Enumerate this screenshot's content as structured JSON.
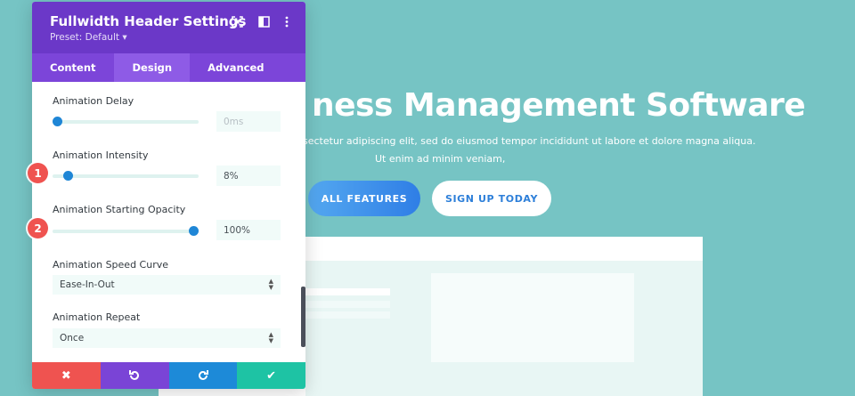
{
  "hero": {
    "title": "ness Management Software",
    "subtitle_line1": "sectetur adipiscing elit, sed do eiusmod tempor incididunt ut labore et dolore magna aliqua.",
    "subtitle_line2": "Ut enim ad minim veniam,",
    "primary_button": "ALL FEATURES",
    "secondary_button": "SIGN UP TODAY"
  },
  "panel": {
    "title": "Fullwidth Header Settings",
    "preset": "Preset: Default ▾",
    "tabs": [
      {
        "label": "Content",
        "active": false
      },
      {
        "label": "Design",
        "active": true
      },
      {
        "label": "Advanced",
        "active": false
      }
    ],
    "fields": {
      "animation_delay": {
        "label": "Animation Delay",
        "value": "0ms",
        "slider_fraction": 0.0
      },
      "animation_intensity": {
        "label": "Animation Intensity",
        "value": "8%",
        "slider_fraction": 0.08
      },
      "animation_starting_opacity": {
        "label": "Animation Starting Opacity",
        "value": "100%",
        "slider_fraction": 1.0
      },
      "animation_speed_curve": {
        "label": "Animation Speed Curve",
        "value": "Ease-In-Out"
      },
      "animation_repeat": {
        "label": "Animation Repeat",
        "value": "Once"
      }
    },
    "badges": [
      "1",
      "2"
    ],
    "footer": {
      "cancel_icon": "close-icon",
      "undo_icon": "undo-icon",
      "redo_icon": "redo-icon",
      "save_icon": "check-icon"
    }
  },
  "colors": {
    "background": "#76c4c4",
    "panel_header": "#6b38c8",
    "tabs_bar": "#7c45d9",
    "active_tab": "#8e5be6",
    "slider_knob": "#1f86d6",
    "badge": "#ef5350",
    "cancel": "#ef5350",
    "undo": "#7a44d6",
    "redo": "#1d8ad8",
    "save": "#1ec3a4"
  }
}
